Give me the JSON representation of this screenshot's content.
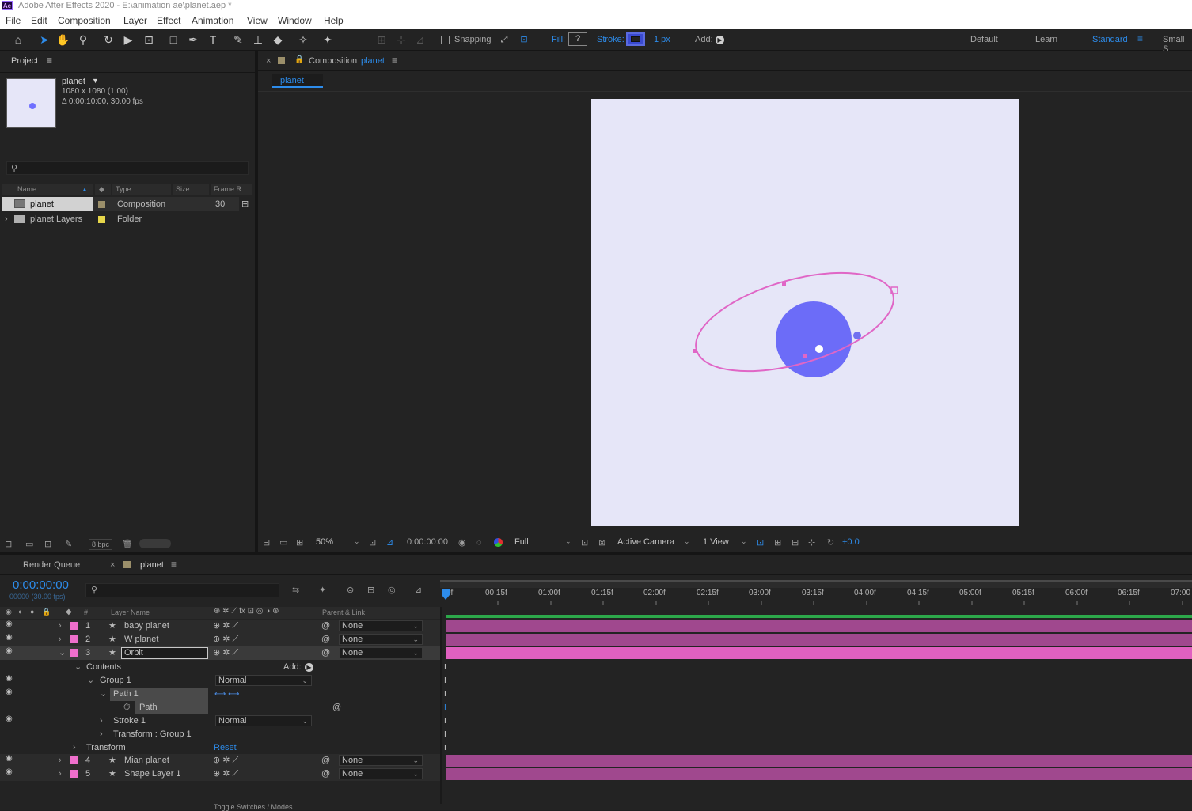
{
  "app": {
    "logo": "Ae",
    "title": "Adobe After Effects 2020 - E:\\animation ae\\planet.aep *"
  },
  "menu": [
    "File",
    "Edit",
    "Composition",
    "Layer",
    "Effect",
    "Animation",
    "View",
    "Window",
    "Help"
  ],
  "toolbar": {
    "snapping": "Snapping",
    "fill_label": "Fill:",
    "fill_value": "?",
    "stroke_label": "Stroke:",
    "stroke_width": "1 px",
    "add_label": "Add:",
    "workspaces": [
      "Default",
      "Learn",
      "Standard",
      "Small S"
    ],
    "active_workspace": "Standard"
  },
  "project": {
    "tab": "Project",
    "comp_name": "planet",
    "comp_size": "1080 x 1080 (1.00)",
    "comp_duration": "Δ 0:00:10:00, 30.00 fps",
    "columns": [
      "Name",
      "Type",
      "Size",
      "Frame R..."
    ],
    "items": [
      {
        "name": "planet",
        "type": "Composition",
        "frame_rate": "30",
        "label_color": "#9b8f6a"
      },
      {
        "name": "planet Layers",
        "type": "Folder",
        "frame_rate": "",
        "label_color": "#e6d64a"
      }
    ],
    "bpc": "8 bpc"
  },
  "comp_viewer": {
    "tab_prefix": "Composition",
    "tab_name": "planet",
    "sub_tab": "planet",
    "zoom": "50%",
    "timecode": "0:00:00:00",
    "resolution": "Full",
    "camera": "Active Camera",
    "views": "1 View",
    "exposure": "+0.0",
    "bg_color": "#e6e6f8",
    "orbit_color": "#e066c6",
    "planet_color": "#6c6cf8"
  },
  "timeline": {
    "tabs": [
      "Render Queue",
      "planet"
    ],
    "timecode": "0:00:00:00",
    "frame_info": "00000 (30.00 fps)",
    "columns": {
      "hash": "#",
      "layer_name": "Layer Name",
      "parent": "Parent & Link"
    },
    "ruler": [
      "0f",
      "00:15f",
      "01:00f",
      "01:15f",
      "02:00f",
      "02:15f",
      "03:00f",
      "03:15f",
      "04:00f",
      "04:15f",
      "05:00f",
      "05:15f",
      "06:00f",
      "06:15f",
      "07:00"
    ],
    "layers_top": [
      {
        "num": "1",
        "name": "baby planet",
        "parent": "None"
      },
      {
        "num": "2",
        "name": "W planet",
        "parent": "None"
      },
      {
        "num": "3",
        "name": "Orbit",
        "parent": "None"
      }
    ],
    "props": {
      "contents": "Contents",
      "add": "Add:",
      "group1": "Group 1",
      "group1_mode": "Normal",
      "path1": "Path 1",
      "path": "Path",
      "stroke1": "Stroke 1",
      "stroke1_mode": "Normal",
      "transform_group": "Transform : Group 1",
      "transform": "Transform",
      "reset": "Reset"
    },
    "layers_bottom": [
      {
        "num": "4",
        "name": "Mian planet",
        "parent": "None"
      },
      {
        "num": "5",
        "name": "Shape Layer 1",
        "parent": "None"
      }
    ],
    "footer": "Toggle Switches / Modes"
  }
}
